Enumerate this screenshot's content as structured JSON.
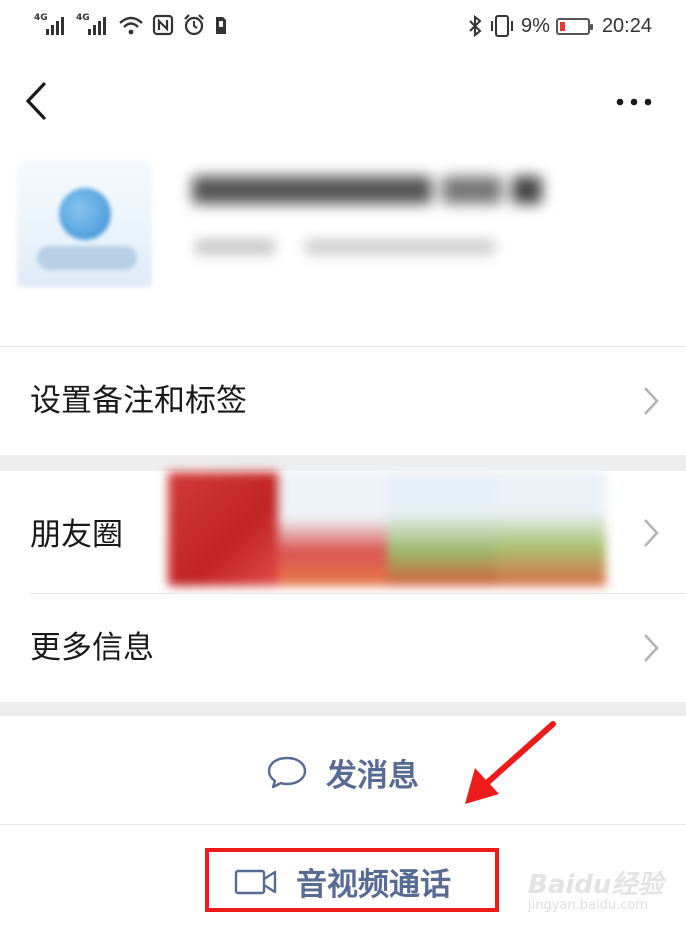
{
  "status_bar": {
    "signal1_label": "4G",
    "signal2_label": "4G",
    "icons_left": [
      "signal-icon",
      "signal-icon",
      "wifi-icon",
      "nfc-icon",
      "alarm-icon",
      "sim-icon"
    ],
    "icons_right": [
      "bluetooth-icon",
      "vibrate-icon",
      "battery-icon"
    ],
    "battery_percent": "9%",
    "battery_level": 0.09,
    "time": "20:24"
  },
  "nav": {
    "back_icon": "chevron-left-icon",
    "more_icon": "more-icon"
  },
  "profile": {
    "name_blurred": true
  },
  "cells": {
    "remark": "设置备注和标签",
    "moments": "朋友圈",
    "more_info": "更多信息"
  },
  "actions": {
    "message": "发消息",
    "call": "音视频通话"
  },
  "watermark": {
    "title": "Baidu经验",
    "sub": "jingyan.baidu.com"
  },
  "colors": {
    "link": "#576b95",
    "highlight": "#ee1b1b",
    "divider": "#ededed"
  }
}
